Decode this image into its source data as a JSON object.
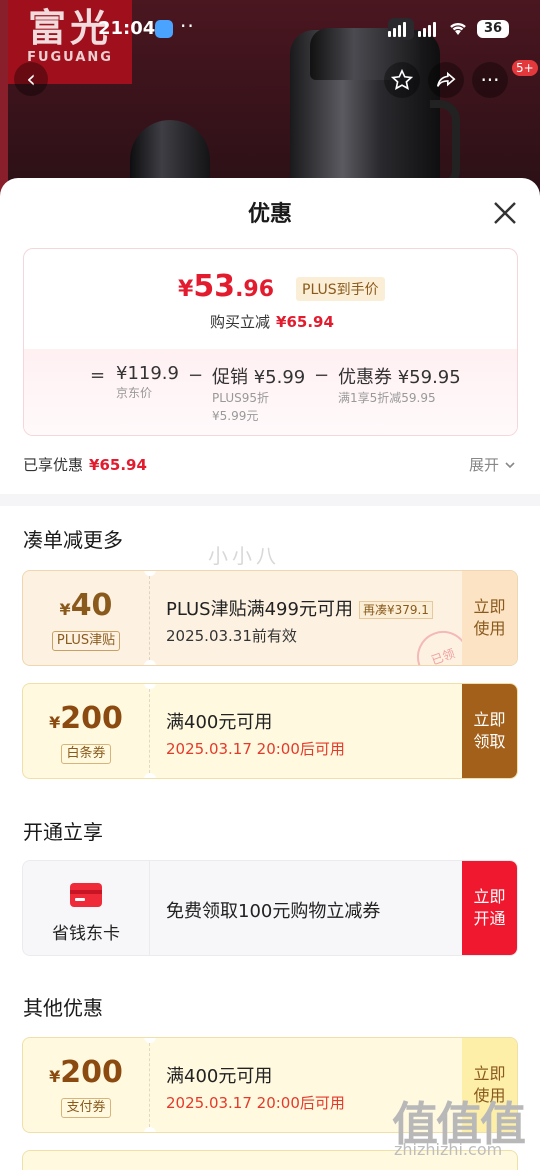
{
  "status_bar": {
    "time": "21:04",
    "dots": "··",
    "battery": "36"
  },
  "logo": {
    "cn": "富光",
    "en": "FUGUANG"
  },
  "nav": {
    "badge": "5+"
  },
  "sheet": {
    "title": "优惠",
    "price_card": {
      "yen": "¥",
      "price_int": "53",
      "price_dec": ".96",
      "tag": "PLUS到手价",
      "sub_label": "购买立减",
      "sub_value": "¥65.94",
      "equation": {
        "eq": "=",
        "items": [
          {
            "value": "¥119.9",
            "lines": [
              "京东价"
            ]
          },
          {
            "value": "促销 ¥5.99",
            "lines": [
              "PLUS95折",
              "¥5.99元"
            ]
          },
          {
            "value": "优惠券 ¥59.95",
            "lines": [
              "满1享5折减59.95"
            ]
          }
        ],
        "minus": "−"
      }
    },
    "enjoyed": {
      "label": "已享优惠",
      "value": "¥65.94",
      "expand": "展开"
    },
    "sections": {
      "more": "凑单减更多",
      "open": "开通立享",
      "other": "其他优惠"
    },
    "watermark": "小小八",
    "coupons": [
      {
        "yen": "¥",
        "amount": "40",
        "kind": "PLUS津贴",
        "title": "PLUS津贴满499元可用",
        "tag": "再凑¥379.1",
        "subtitle": "2025.03.31前有效",
        "button": [
          "立即",
          "使用"
        ],
        "stamp": "已领"
      },
      {
        "yen": "¥",
        "amount": "200",
        "kind": "白条券",
        "title": "满400元可用",
        "subtitle": "2025.03.17 20:00后可用",
        "button": [
          "立即",
          "领取"
        ]
      },
      {
        "card_name": "省钱东卡",
        "title": "免费领取100元购物立减券",
        "button": [
          "立即",
          "开通"
        ]
      },
      {
        "yen": "¥",
        "amount": "200",
        "kind": "支付券",
        "title": "满400元可用",
        "subtitle": "2025.03.17 20:00后可用",
        "button": [
          "立即",
          "使用"
        ]
      }
    ]
  },
  "footer_watermark": {
    "big": "值值值",
    "small": "zhizhizhi.com"
  },
  "colors": {
    "accent": "#e21c2e",
    "gold": "#8a5a1c",
    "brown_button": "#a3601a",
    "red_button": "#f0182f"
  }
}
